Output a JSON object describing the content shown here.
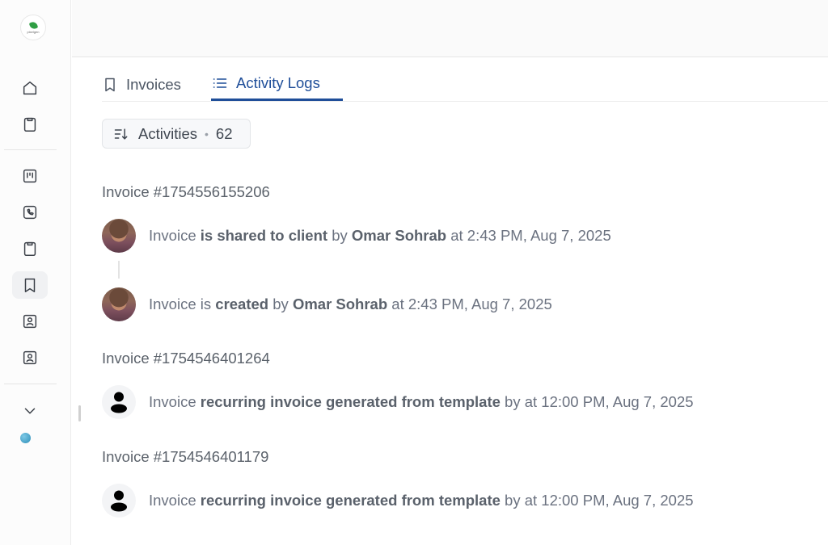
{
  "sidebar": {
    "logo_text": "pixelgen",
    "icons": [
      "home-icon",
      "clipboard-icon",
      "kanban-icon",
      "phone-icon",
      "clipboard-list-icon",
      "bookmark-icon",
      "contact-card-icon",
      "user-card-icon",
      "chevron-down-icon"
    ]
  },
  "tabs": {
    "invoices": "Invoices",
    "activity_logs": "Activity Logs",
    "active": "activity_logs"
  },
  "activities": {
    "label": "Activities",
    "separator": "•",
    "count": "62"
  },
  "groups": [
    {
      "title": "Invoice #1754556155206",
      "entries": [
        {
          "avatar": "photo",
          "subject": "Invoice",
          "action_prefix": "",
          "action": "is shared to client",
          "by": "by",
          "user": "Omar Sohrab",
          "time": "at 2:43 PM, Aug 7, 2025"
        },
        {
          "avatar": "photo",
          "subject": "Invoice",
          "action_prefix": "is",
          "action": "created",
          "by": "by",
          "user": "Omar Sohrab",
          "time": "at 2:43 PM, Aug 7, 2025"
        }
      ]
    },
    {
      "title": "Invoice #1754546401264",
      "entries": [
        {
          "avatar": "generic",
          "subject": "Invoice",
          "action_prefix": "",
          "action": "recurring invoice generated from template",
          "by": "by",
          "user": "",
          "time": "at 12:00 PM, Aug 7, 2025"
        }
      ]
    },
    {
      "title": "Invoice #1754546401179",
      "entries": [
        {
          "avatar": "generic",
          "subject": "Invoice",
          "action_prefix": "",
          "action": "recurring invoice generated from template",
          "by": "by",
          "user": "",
          "time": "at 12:00 PM, Aug 7, 2025"
        }
      ]
    }
  ],
  "colors": {
    "accent": "#1f4e99",
    "text": "#6b7280",
    "status_dot": "#3a9cc6"
  }
}
